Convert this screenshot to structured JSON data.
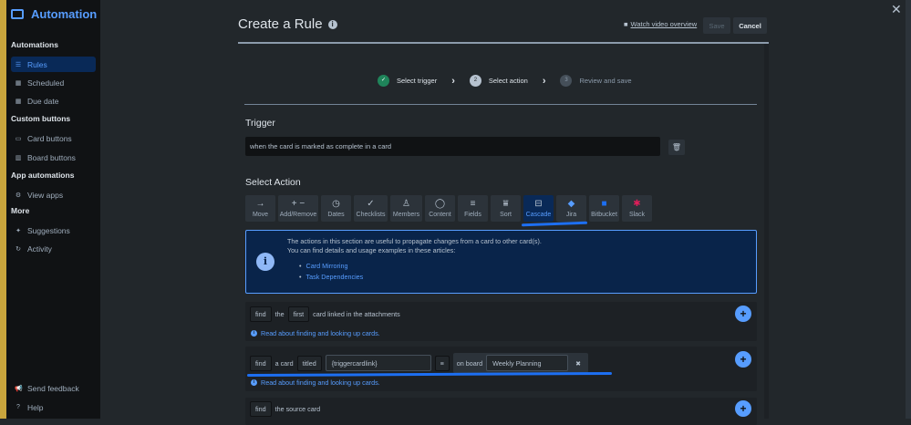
{
  "sidebar": {
    "title": "Automation",
    "sections": [
      {
        "heading": "Automations",
        "items": [
          "Rules",
          "Scheduled",
          "Due date"
        ]
      },
      {
        "heading": "Custom buttons",
        "items": [
          "Card buttons",
          "Board buttons"
        ]
      },
      {
        "heading": "App automations",
        "items": [
          "View apps"
        ]
      },
      {
        "heading": "More",
        "items": [
          "Suggestions",
          "Activity"
        ]
      }
    ],
    "footer": [
      "Send feedback",
      "Help"
    ]
  },
  "header": {
    "title": "Create a Rule",
    "watch": "Watch video overview",
    "save": "Save",
    "cancel": "Cancel"
  },
  "steps": [
    {
      "num": "✓",
      "label": "Select trigger"
    },
    {
      "num": "2",
      "label": "Select action"
    },
    {
      "num": "3",
      "label": "Review and save"
    }
  ],
  "trigger": {
    "heading": "Trigger",
    "text": "when the card is marked as complete in a card"
  },
  "select_action": {
    "heading": "Select Action",
    "tabs": [
      "Move",
      "Add/Remove",
      "Dates",
      "Checklists",
      "Members",
      "Content",
      "Fields",
      "Sort",
      "Cascade",
      "Jira",
      "Bitbucket",
      "Slack"
    ],
    "selected": "Cascade"
  },
  "info": {
    "line1": "The actions in this section are useful to propagate changes from a card to other card(s).",
    "line2": "You can find details and usage examples in these articles:",
    "links": [
      "Card Mirroring",
      "Task Dependencies"
    ]
  },
  "rows": [
    {
      "find": "find",
      "w1": "the",
      "which": "first",
      "rest": "card linked in the attachments",
      "link": "Read about finding and looking up cards."
    },
    {
      "find": "find",
      "w1": "a card",
      "mode": "titled",
      "value": "{triggercardlink}",
      "onboard": "on board",
      "board": "Weekly Planning",
      "link": "Read about finding and looking up cards."
    },
    {
      "find": "find",
      "rest": "the source card"
    }
  ]
}
